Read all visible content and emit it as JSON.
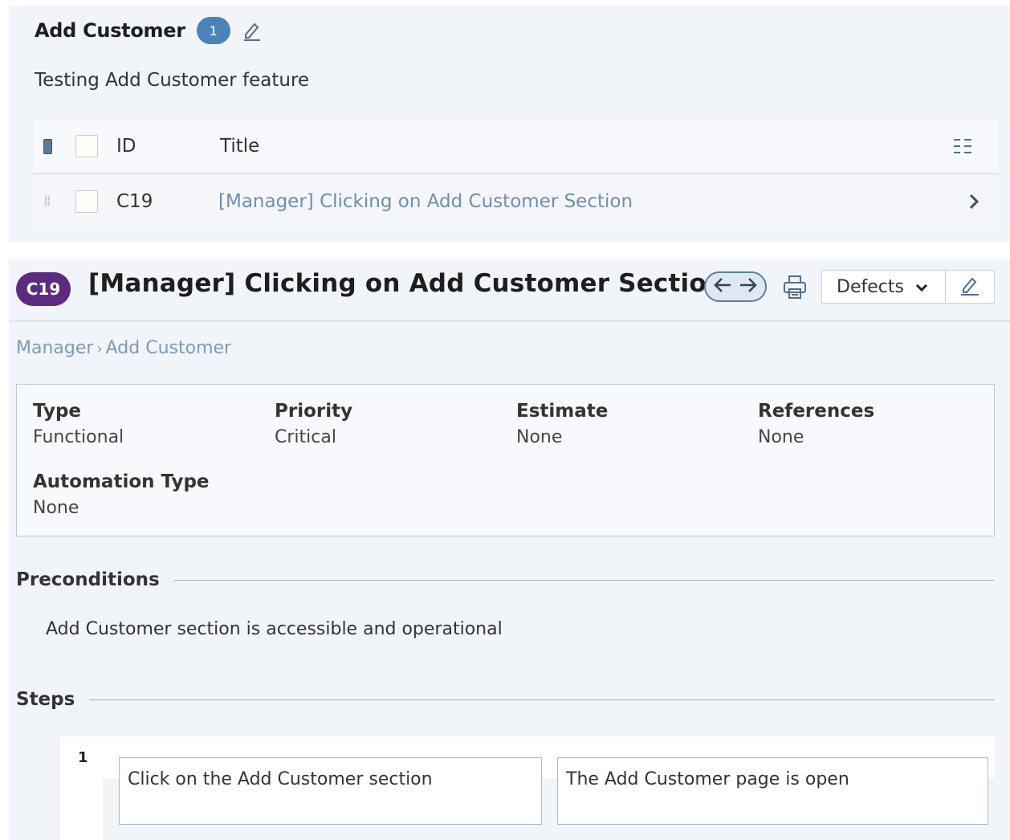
{
  "section": {
    "title": "Add Customer",
    "count": "1",
    "description": "Testing Add Customer feature"
  },
  "table": {
    "headers": {
      "id": "ID",
      "title": "Title"
    },
    "rows": [
      {
        "id": "C19",
        "title": "[Manager] Clicking on Add Customer Section"
      }
    ]
  },
  "case": {
    "badge": "C19",
    "title": "[Manager] Clicking on Add Customer Section",
    "defects_label": "Defects",
    "breadcrumb": [
      "Manager",
      "Add Customer"
    ],
    "properties": {
      "type_label": "Type",
      "type_value": "Functional",
      "priority_label": "Priority",
      "priority_value": "Critical",
      "estimate_label": "Estimate",
      "estimate_value": "None",
      "references_label": "References",
      "references_value": "None",
      "automation_label": "Automation Type",
      "automation_value": "None"
    },
    "preconditions_label": "Preconditions",
    "preconditions_text": "Add Customer section is accessible and operational",
    "steps_label": "Steps",
    "steps": [
      {
        "number": "1",
        "action": "Click on the Add Customer section",
        "expected": "The Add Customer page is open"
      }
    ]
  },
  "icons": {
    "edit": "pencil-icon",
    "prev": "arrow-left-icon",
    "next": "arrow-right-icon",
    "print": "printer-icon",
    "dropdown": "chevron-down-icon",
    "row_open": "chevron-right-icon",
    "columns": "columns-icon",
    "drag": "drag-handle-icon"
  },
  "colors": {
    "panel_bg": "#f1f4f8",
    "count_badge": "#4a83b8",
    "case_badge": "#5c2a7e",
    "link": "#6f8eae"
  }
}
